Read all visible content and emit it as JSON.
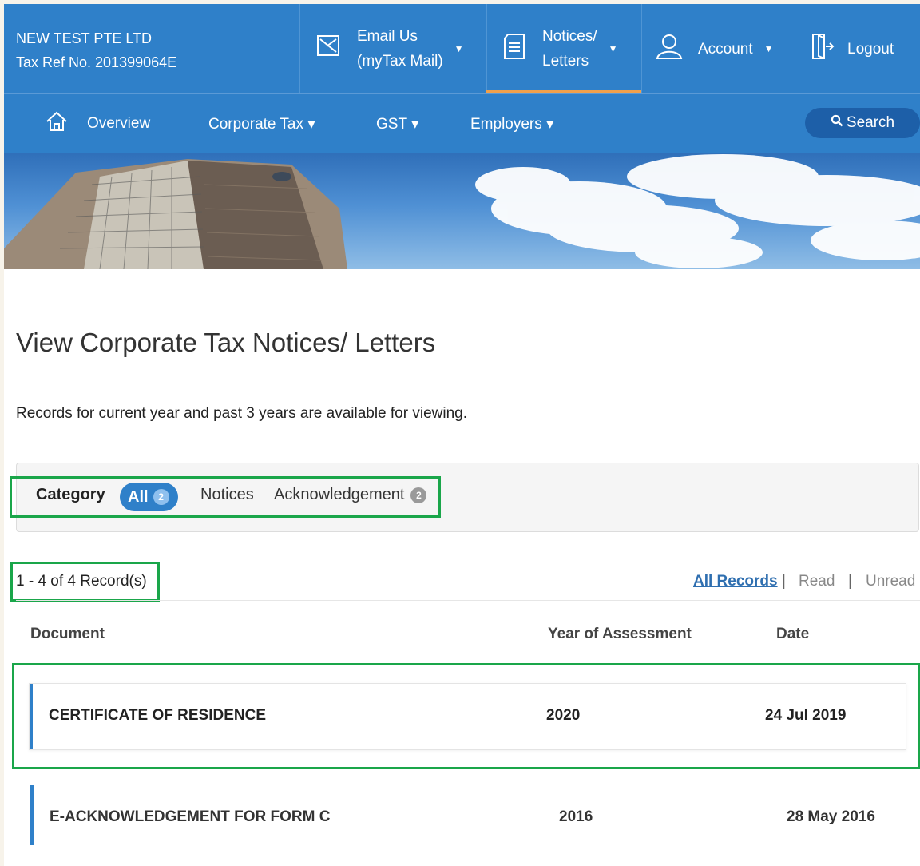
{
  "header": {
    "company_name": "NEW TEST PTE LTD",
    "tax_ref": "Tax Ref No. 201399064E",
    "email_line1": "Email Us",
    "email_line2": "(myTax Mail)",
    "notices_line1": "Notices/",
    "notices_line2": "Letters",
    "account_label": "Account",
    "logout_label": "Logout",
    "caret": "▼"
  },
  "nav": {
    "overview": "Overview",
    "corporate_tax": "Corporate Tax ▾",
    "gst": "GST ▾",
    "employers": "Employers ▾",
    "search": "Search"
  },
  "content": {
    "title": "View Corporate Tax Notices/ Letters",
    "subtitle": "Records for current year and past 3 years are available for viewing."
  },
  "filter": {
    "category_label": "Category",
    "all_label": "All",
    "all_count": "2",
    "notices_label": "Notices",
    "ack_label": "Acknowledgement",
    "ack_count": "2"
  },
  "records": {
    "count_text": "1 - 4 of 4 Record(s)",
    "all_records": "All Records",
    "sep": "|",
    "read": "Read",
    "unread": "Unread"
  },
  "table": {
    "headers": {
      "document": "Document",
      "year": "Year of Assessment",
      "date": "Date"
    },
    "rows": [
      {
        "document": "CERTIFICATE OF RESIDENCE",
        "year": "2020",
        "date": "24 Jul 2019"
      },
      {
        "document": "E-ACKNOWLEDGEMENT FOR FORM C",
        "year": "2016",
        "date": "28 May 2016"
      }
    ]
  },
  "colors": {
    "primary": "#2f80c9",
    "dark_blue": "#1d5fa8",
    "accent_orange": "#f0a04b",
    "highlight_green": "#1aa64a"
  }
}
